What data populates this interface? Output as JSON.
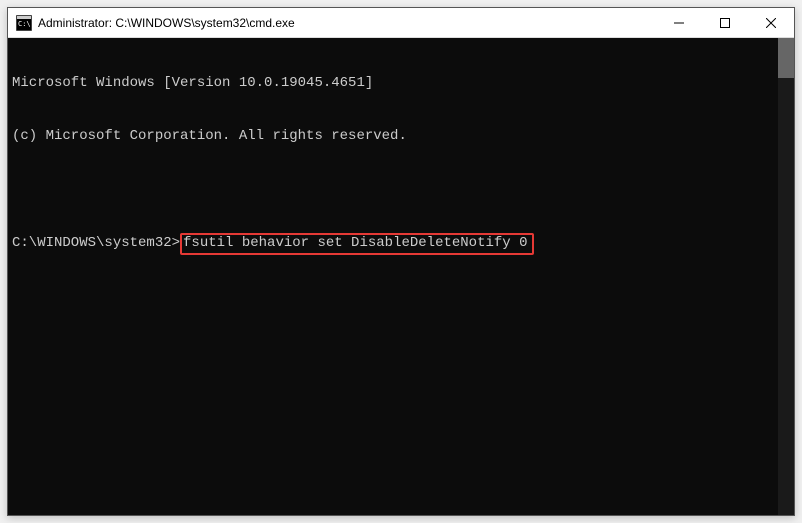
{
  "titlebar": {
    "title": "Administrator: C:\\WINDOWS\\system32\\cmd.exe"
  },
  "terminal": {
    "line1": "Microsoft Windows [Version 10.0.19045.4651]",
    "line2": "(c) Microsoft Corporation. All rights reserved.",
    "prompt": "C:\\WINDOWS\\system32>",
    "command": "fsutil behavior set DisableDeleteNotify 0"
  }
}
